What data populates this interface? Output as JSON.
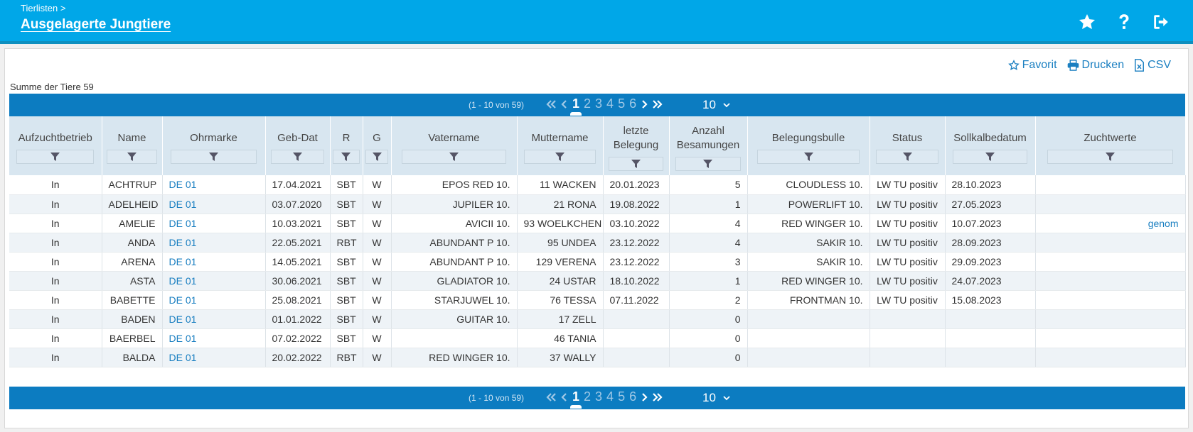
{
  "header": {
    "breadcrumb": "Tierlisten >",
    "title": "Ausgelagerte Jungtiere",
    "icons": [
      "star-icon",
      "help-icon",
      "logout-icon"
    ]
  },
  "toolbar": {
    "favorit": "Favorit",
    "drucken": "Drucken",
    "csv": "CSV"
  },
  "summary": "Summe der Tiere 59",
  "pager": {
    "range": "(1 - 10 von 59)",
    "pages": [
      "1",
      "2",
      "3",
      "4",
      "5",
      "6"
    ],
    "current": "1",
    "page_size": "10"
  },
  "columns": [
    "Aufzuchtbetrieb",
    "Name",
    "Ohrmarke",
    "Geb-Dat",
    "R",
    "G",
    "Vatername",
    "Muttername",
    "letzte Belegung",
    "Anzahl Besamungen",
    "Belegungsbulle",
    "Status",
    "Sollkalbedatum",
    "Zuchtwerte"
  ],
  "rows": [
    {
      "betrieb": "In",
      "name": "ACHTRUP",
      "ohrmarke": "DE 01",
      "geb": "17.04.2021",
      "r": "SBT",
      "g": "W",
      "vater": "EPOS RED 10.",
      "mutter": "11 WACKEN",
      "belegung": "20.01.2023",
      "anzahl": "5",
      "bulle": "CLOUDLESS 10.",
      "status": "LW TU positiv",
      "soll": "28.10.2023",
      "zw": ""
    },
    {
      "betrieb": "In",
      "name": "ADELHEID",
      "ohrmarke": "DE 01",
      "geb": "03.07.2020",
      "r": "SBT",
      "g": "W",
      "vater": "JUPILER 10.",
      "mutter": "21 RONA",
      "belegung": "19.08.2022",
      "anzahl": "1",
      "bulle": "POWERLIFT 10.",
      "status": "LW TU positiv",
      "soll": "27.05.2023",
      "zw": ""
    },
    {
      "betrieb": "In",
      "name": "AMELIE",
      "ohrmarke": "DE 01",
      "geb": "10.03.2021",
      "r": "SBT",
      "g": "W",
      "vater": "AVICII 10.",
      "mutter": "93 WOELKCHEN",
      "belegung": "03.10.2022",
      "anzahl": "4",
      "bulle": "RED WINGER 10.",
      "status": "LW TU positiv",
      "soll": "10.07.2023",
      "zw": "genom"
    },
    {
      "betrieb": "In",
      "name": "ANDA",
      "ohrmarke": "DE 01",
      "geb": "22.05.2021",
      "r": "RBT",
      "g": "W",
      "vater": "ABUNDANT P 10.",
      "mutter": "95 UNDEA",
      "belegung": "23.12.2022",
      "anzahl": "4",
      "bulle": "SAKIR 10.",
      "status": "LW TU positiv",
      "soll": "28.09.2023",
      "zw": ""
    },
    {
      "betrieb": "In",
      "name": "ARENA",
      "ohrmarke": "DE 01",
      "geb": "14.05.2021",
      "r": "SBT",
      "g": "W",
      "vater": "ABUNDANT P 10.",
      "mutter": "129 VERENA",
      "belegung": "23.12.2022",
      "anzahl": "3",
      "bulle": "SAKIR 10.",
      "status": "LW TU positiv",
      "soll": "29.09.2023",
      "zw": ""
    },
    {
      "betrieb": "In",
      "name": "ASTA",
      "ohrmarke": "DE 01",
      "geb": "30.06.2021",
      "r": "SBT",
      "g": "W",
      "vater": "GLADIATOR 10.",
      "mutter": "24 USTAR",
      "belegung": "18.10.2022",
      "anzahl": "1",
      "bulle": "RED WINGER 10.",
      "status": "LW TU positiv",
      "soll": "24.07.2023",
      "zw": ""
    },
    {
      "betrieb": "In",
      "name": "BABETTE",
      "ohrmarke": "DE 01",
      "geb": "25.08.2021",
      "r": "SBT",
      "g": "W",
      "vater": "STARJUWEL 10.",
      "mutter": "76 TESSA",
      "belegung": "07.11.2022",
      "anzahl": "2",
      "bulle": "FRONTMAN 10.",
      "status": "LW TU positiv",
      "soll": "15.08.2023",
      "zw": ""
    },
    {
      "betrieb": "In",
      "name": "BADEN",
      "ohrmarke": "DE 01",
      "geb": "01.01.2022",
      "r": "SBT",
      "g": "W",
      "vater": "GUITAR 10.",
      "mutter": "17 ZELL",
      "belegung": "",
      "anzahl": "0",
      "bulle": "",
      "status": "",
      "soll": "",
      "zw": ""
    },
    {
      "betrieb": "In",
      "name": "BAERBEL",
      "ohrmarke": "DE 01",
      "geb": "07.02.2022",
      "r": "SBT",
      "g": "W",
      "vater": "",
      "mutter": "46 TANIA",
      "belegung": "",
      "anzahl": "0",
      "bulle": "",
      "status": "",
      "soll": "",
      "zw": ""
    },
    {
      "betrieb": "In",
      "name": "BALDA",
      "ohrmarke": "DE 01",
      "geb": "20.02.2022",
      "r": "RBT",
      "g": "W",
      "vater": "RED WINGER 10.",
      "mutter": "37 WALLY",
      "belegung": "",
      "anzahl": "0",
      "bulle": "",
      "status": "",
      "soll": "",
      "zw": ""
    }
  ]
}
